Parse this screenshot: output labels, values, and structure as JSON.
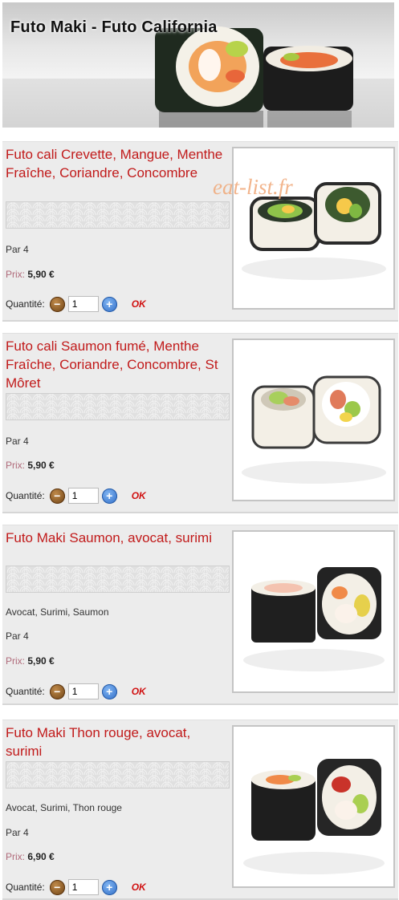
{
  "header": {
    "title": "Futo Maki - Futo California"
  },
  "watermark": "eat-list.fr",
  "labels": {
    "qty": "Quantité:",
    "price": "Prix:",
    "ok": "OK"
  },
  "products": [
    {
      "name": "Futo cali Crevette, Mangue, Menthe Fraîche, Coriandre, Concombre",
      "description": "",
      "portion": "Par 4",
      "price": "5,90 €",
      "quantity": "1",
      "image_icon": "sushi-roll-icon"
    },
    {
      "name": "Futo cali Saumon fumé, Menthe Fraîche, Coriandre, Concombre, St Môret",
      "description": "",
      "portion": "Par 4",
      "price": "5,90 €",
      "quantity": "1",
      "image_icon": "sushi-roll-icon"
    },
    {
      "name": "Futo Maki Saumon, avocat, surimi",
      "description": "Avocat, Surimi, Saumon",
      "portion": "Par 4",
      "price": "5,90 €",
      "quantity": "1",
      "image_icon": "sushi-roll-icon"
    },
    {
      "name": "Futo Maki Thon rouge, avocat, surimi",
      "description": "Avocat, Surimi, Thon rouge",
      "portion": "Par 4",
      "price": "6,90 €",
      "quantity": "1",
      "image_icon": "sushi-roll-icon"
    }
  ]
}
